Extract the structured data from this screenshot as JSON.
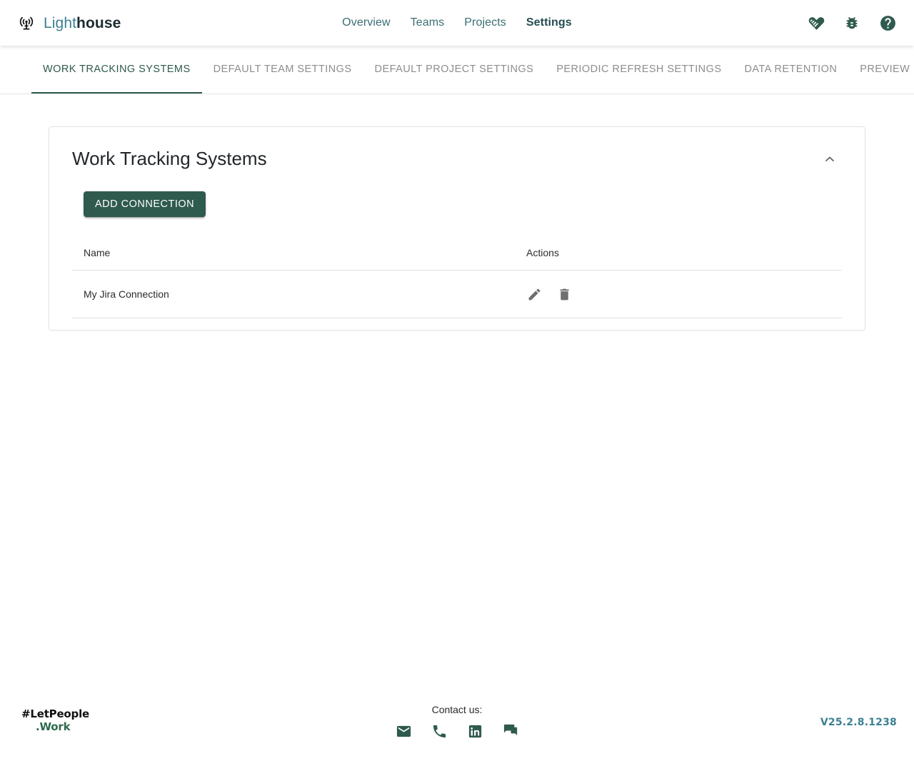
{
  "header": {
    "brand": {
      "part1": "Light",
      "part2": "house",
      "icon": "broadcast-tower-icon"
    },
    "nav": [
      {
        "label": "Overview",
        "active": false
      },
      {
        "label": "Teams",
        "active": false
      },
      {
        "label": "Projects",
        "active": false
      },
      {
        "label": "Settings",
        "active": true
      }
    ],
    "actions": [
      {
        "name": "contribute-icon",
        "title": "Contribute"
      },
      {
        "name": "bug-icon",
        "title": "Report a Bug"
      },
      {
        "name": "help-icon",
        "title": "Help"
      }
    ]
  },
  "tabs": [
    {
      "label": "WORK TRACKING SYSTEMS",
      "active": true
    },
    {
      "label": "DEFAULT TEAM SETTINGS",
      "active": false
    },
    {
      "label": "DEFAULT PROJECT SETTINGS",
      "active": false
    },
    {
      "label": "PERIODIC REFRESH SETTINGS",
      "active": false
    },
    {
      "label": "DATA RETENTION",
      "active": false
    },
    {
      "label": "PREVIEW",
      "active": false
    }
  ],
  "card": {
    "title": "Work Tracking Systems",
    "collapse_icon": "chevron-up-icon",
    "add_button_label": "ADD CONNECTION",
    "table": {
      "columns": [
        "Name",
        "Actions"
      ],
      "rows": [
        {
          "name": "My Jira Connection",
          "actions": [
            "edit-icon",
            "delete-icon"
          ]
        }
      ]
    }
  },
  "footer": {
    "logo": {
      "line1": "#LetPeople",
      "line2": ".Work"
    },
    "contact_label": "Contact us:",
    "contact_icons": [
      {
        "name": "email-icon",
        "title": "Email"
      },
      {
        "name": "phone-icon",
        "title": "Phone"
      },
      {
        "name": "linkedin-icon",
        "title": "LinkedIn"
      },
      {
        "name": "forum-icon",
        "title": "Forum"
      }
    ],
    "version": "V25.2.8.1238"
  },
  "colors": {
    "primary": "#2f5a4e",
    "brand_accent": "#3c7f93",
    "tab_inactive": "#8d8d8d",
    "nav_link": "#3a6d72"
  }
}
